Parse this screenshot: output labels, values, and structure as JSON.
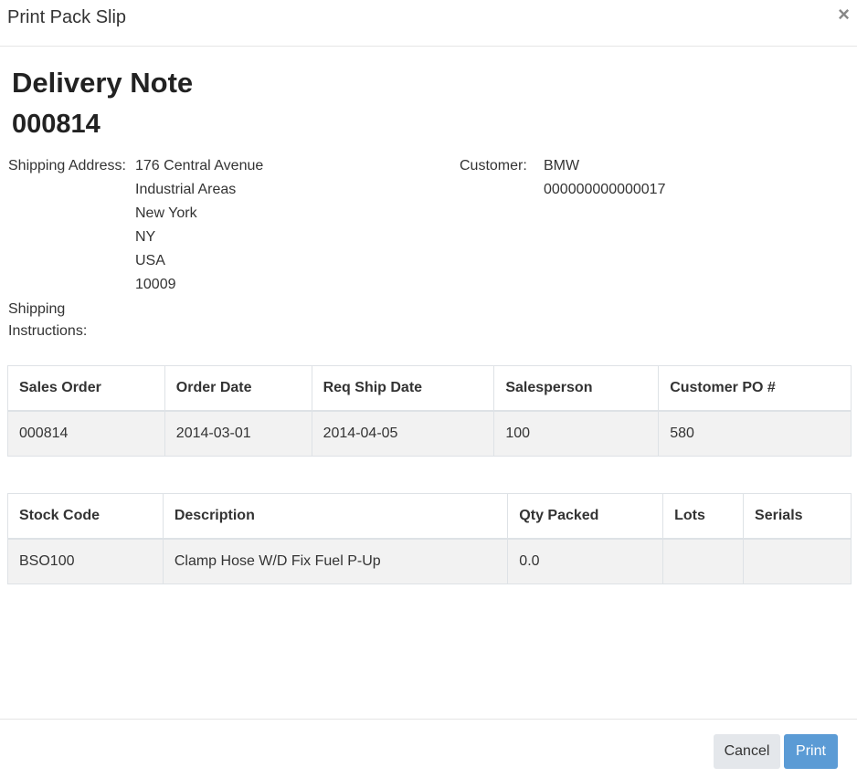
{
  "modal": {
    "title": "Print Pack Slip",
    "close_symbol": "×"
  },
  "document": {
    "title": "Delivery Note",
    "number": "000814"
  },
  "shipping": {
    "label": "Shipping Address:",
    "address_lines": [
      "176 Central Avenue",
      "Industrial Areas",
      "New York",
      "NY",
      "USA",
      "10009"
    ],
    "instructions_label": "Shipping Instructions:"
  },
  "customer": {
    "label": "Customer:",
    "name": "BMW",
    "code": "000000000000017"
  },
  "order_table": {
    "headers": [
      "Sales Order",
      "Order Date",
      "Req Ship Date",
      "Salesperson",
      "Customer PO #"
    ],
    "rows": [
      [
        "000814",
        "2014-03-01",
        "2014-04-05",
        "100",
        "580"
      ]
    ]
  },
  "items_table": {
    "headers": [
      "Stock Code",
      "Description",
      "Qty Packed",
      "Lots",
      "Serials"
    ],
    "rows": [
      [
        "BSO100",
        "Clamp Hose W/D Fix Fuel P-Up",
        "0.0",
        "",
        ""
      ]
    ]
  },
  "footer": {
    "cancel_label": "Cancel",
    "print_label": "Print"
  },
  "colors": {
    "print_button": "#5b9bd5",
    "cancel_button": "#e4e7eb",
    "row_background": "#f2f2f2"
  }
}
